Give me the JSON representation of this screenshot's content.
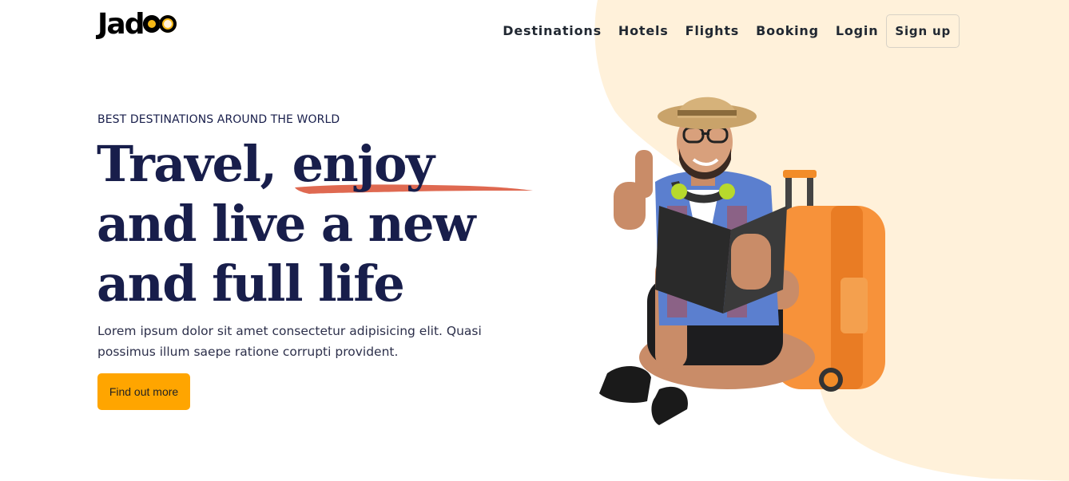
{
  "brand": {
    "logo_text": "Jad",
    "accent": "#F7B916",
    "peach_bg": "#FFF1DA",
    "navy": "#181E4B",
    "orange": "#FFA500"
  },
  "nav": {
    "items": [
      "Destinations",
      "Hotels",
      "Flights",
      "Booking",
      "Login"
    ],
    "signup_label": "Sign up"
  },
  "hero": {
    "tagline": "BEST DESTINATIONS AROUND THE WORLD",
    "headline_line1": "Travel, enjoy",
    "headline_line2": "and live a new",
    "headline_line3": "and full life",
    "body": "Lorem ipsum dolor sit amet consectetur adipisicing elit. Quasi possimus illum saepe ratione corrupti provident.",
    "cta_label": "Find out more",
    "image_subject": "traveler-with-suitcase"
  }
}
